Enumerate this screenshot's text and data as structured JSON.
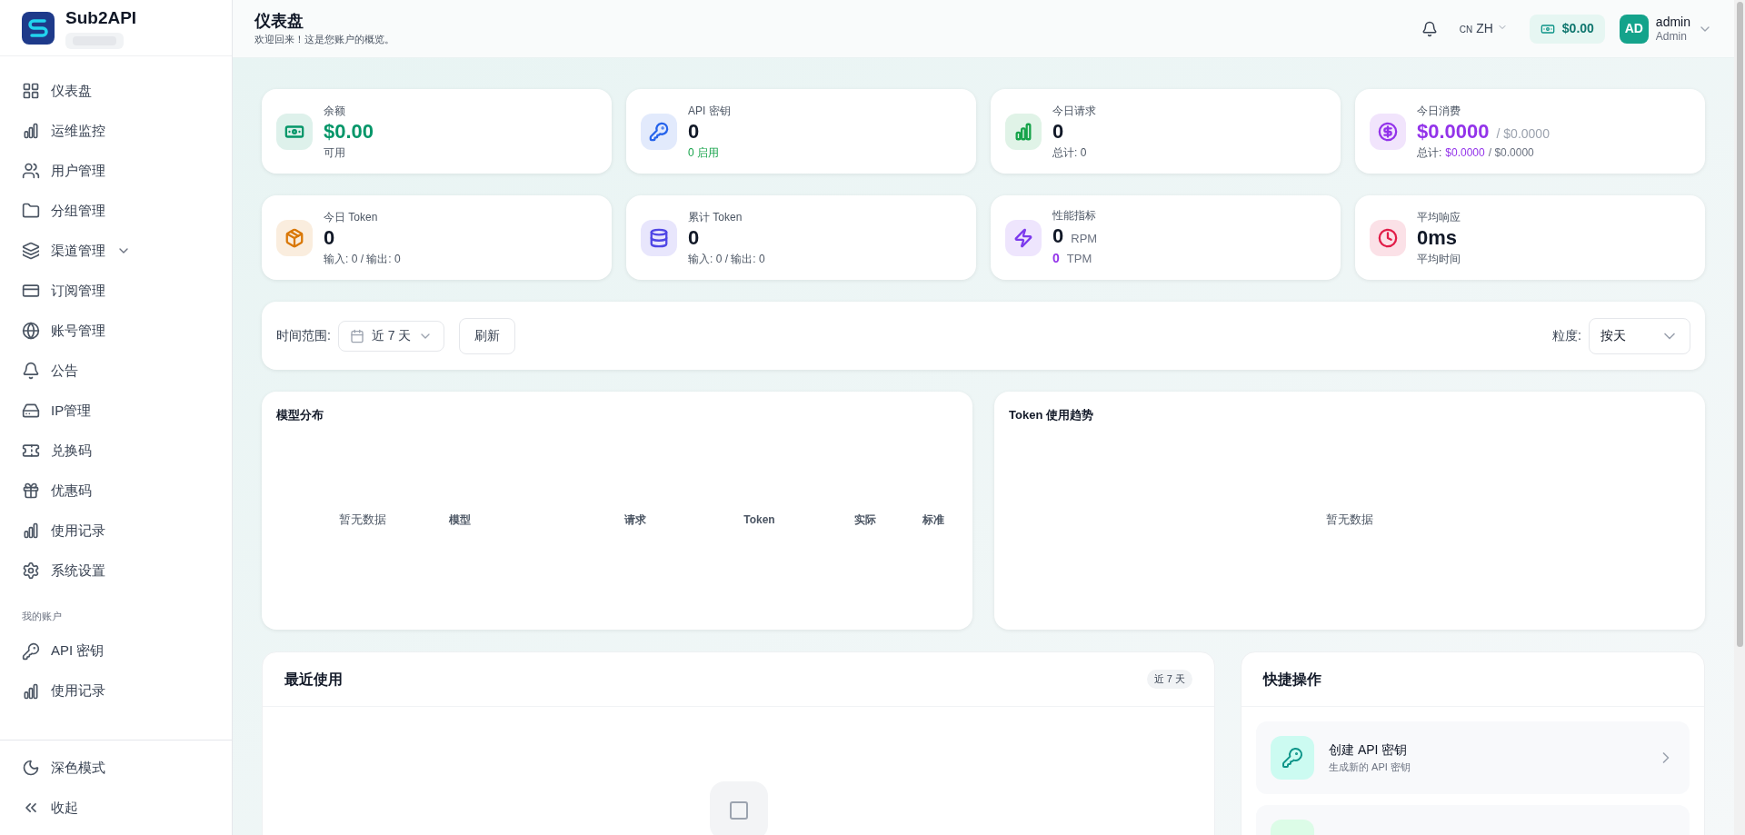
{
  "brand": {
    "name": "Sub2API"
  },
  "sidebar": {
    "items": [
      {
        "label": "仪表盘",
        "kind": "grid",
        "expandable": false
      },
      {
        "label": "运维监控",
        "kind": "bars",
        "expandable": false
      },
      {
        "label": "用户管理",
        "kind": "users",
        "expandable": false
      },
      {
        "label": "分组管理",
        "kind": "folder",
        "expandable": false
      },
      {
        "label": "渠道管理",
        "kind": "layers",
        "expandable": true
      },
      {
        "label": "订阅管理",
        "kind": "card",
        "expandable": false
      },
      {
        "label": "账号管理",
        "kind": "globe",
        "expandable": false
      },
      {
        "label": "公告",
        "kind": "bell",
        "expandable": false
      },
      {
        "label": "IP管理",
        "kind": "server",
        "expandable": false
      },
      {
        "label": "兑换码",
        "kind": "ticket",
        "expandable": false
      },
      {
        "label": "优惠码",
        "kind": "gift",
        "expandable": false
      },
      {
        "label": "使用记录",
        "kind": "bars",
        "expandable": false
      },
      {
        "label": "系统设置",
        "kind": "gear",
        "expandable": false
      }
    ],
    "section_title": "我的账户",
    "account_items": [
      {
        "label": "API 密钥",
        "kind": "key",
        "expandable": false
      },
      {
        "label": "使用记录",
        "kind": "bars",
        "expandable": false
      }
    ],
    "footer_items": [
      {
        "label": "深色模式",
        "kind": "moon",
        "expandable": false
      },
      {
        "label": "收起",
        "kind": "collapse",
        "expandable": false
      }
    ]
  },
  "header": {
    "title": "仪表盘",
    "subtitle": "欢迎回来！这是您账户的概览。",
    "lang_flag": "CN",
    "lang": "ZH",
    "balance": "$0.00",
    "avatar": "AD",
    "user_name": "admin",
    "user_role": "Admin"
  },
  "stat_cards": [
    {
      "label": "余额",
      "kind": "money",
      "color": "#059669",
      "value": {
        "text": "$0.00",
        "color": "#059669"
      },
      "sub": [
        {
          "text": "可用"
        }
      ]
    },
    {
      "label": "API 密钥",
      "kind": "key",
      "color": "#2563eb",
      "value": {
        "text": "0",
        "color": "#111827"
      },
      "sub": [
        {
          "text": "0 启用",
          "color": "#16a34a"
        }
      ]
    },
    {
      "label": "今日请求",
      "kind": "bars",
      "color": "#16a34a",
      "value": {
        "text": "0",
        "color": "#111827"
      },
      "sub": [
        {
          "text": "总计: 0"
        }
      ]
    },
    {
      "label": "今日消费",
      "kind": "dollar",
      "color": "#9333ea",
      "value": {
        "text": "$0.0000",
        "color": "#9333ea"
      },
      "value_suffix": "/ $0.0000",
      "sub": [
        {
          "text": "总计:"
        },
        {
          "text": "$0.0000",
          "color": "#9333ea"
        },
        {
          "text": "/ $0.0000",
          "color": "#6b7280"
        }
      ]
    },
    {
      "label": "今日 Token",
      "kind": "box",
      "color": "#d97706",
      "value": {
        "text": "0",
        "color": "#111827"
      },
      "sub": [
        {
          "text": "输入: 0 / 输出: 0"
        }
      ]
    },
    {
      "label": "累计 Token",
      "kind": "database",
      "color": "#4f46e5",
      "value": {
        "text": "0",
        "color": "#111827"
      },
      "sub": [
        {
          "text": "输入: 0 / 输出: 0"
        }
      ]
    },
    {
      "label": "性能指标",
      "kind": "zap",
      "color": "#7c3aed",
      "value": {
        "text": "0",
        "color": "#111827"
      },
      "unit": "RPM",
      "second": {
        "value": {
          "text": "0",
          "color": "#9333ea"
        },
        "unit": "TPM"
      }
    },
    {
      "label": "平均响应",
      "kind": "clock",
      "color": "#e11d48",
      "value": {
        "text": "0ms",
        "color": "#111827"
      },
      "sub": [
        {
          "text": "平均时间"
        }
      ]
    }
  ],
  "filters": {
    "range_label": "时间范围:",
    "range_value": "近 7 天",
    "refresh": "刷新",
    "granularity_label": "粒度:",
    "granularity_value": "按天"
  },
  "model_panel": {
    "title": "模型分布",
    "empty": "暂无数据",
    "columns": [
      "模型",
      "请求",
      "Token",
      "实际",
      "标准"
    ]
  },
  "token_panel": {
    "title": "Token 使用趋势",
    "empty": "暂无数据"
  },
  "recent": {
    "title": "最近使用",
    "badge": "近 7 天"
  },
  "quick": {
    "title": "快捷操作",
    "actions": [
      {
        "title": "创建 API 密钥",
        "subtitle": "生成新的 API 密钥",
        "kind": "key"
      }
    ]
  }
}
